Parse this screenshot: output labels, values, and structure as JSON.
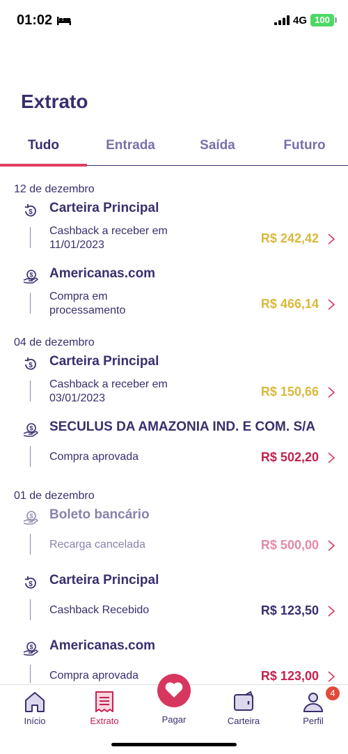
{
  "status": {
    "time": "01:02",
    "network": "4G",
    "battery": "100"
  },
  "header": {
    "title": "Extrato"
  },
  "tabs": [
    {
      "label": "Tudo",
      "active": true
    },
    {
      "label": "Entrada",
      "active": false
    },
    {
      "label": "Saída",
      "active": false
    },
    {
      "label": "Futuro",
      "active": false
    }
  ],
  "groups": [
    {
      "date": "12 de dezembro",
      "entries": [
        {
          "icon": "cashback-icon",
          "name": "Carteira Principal",
          "desc": "Cashback a receber em 11/01/2023",
          "amount": "R$ 242,42",
          "status": "pending"
        },
        {
          "icon": "money-hand-icon",
          "name": "Americanas.com",
          "desc": "Compra em processamento",
          "amount": "R$ 466,14",
          "status": "pending"
        }
      ]
    },
    {
      "date": "04 de dezembro",
      "entries": [
        {
          "icon": "cashback-icon",
          "name": "Carteira Principal",
          "desc": "Cashback a receber em 03/01/2023",
          "amount": "R$ 150,66",
          "status": "pending"
        },
        {
          "icon": "money-hand-icon",
          "name": "SECULUS DA AMAZONIA IND. E COM. S/A",
          "desc": "Compra aprovada",
          "amount": "R$ 502,20",
          "status": "approved"
        }
      ]
    },
    {
      "date": "01 de dezembro",
      "entries": [
        {
          "icon": "money-hand-icon",
          "name": "Boleto bancário",
          "desc": "Recarga cancelada",
          "amount": "R$ 500,00",
          "status": "cancelled"
        },
        {
          "icon": "cashback-icon",
          "name": "Carteira Principal",
          "desc": "Cashback Recebido",
          "amount": "R$ 123,50",
          "status": "received"
        },
        {
          "icon": "money-hand-icon",
          "name": "Americanas.com",
          "desc": "Compra aprovada",
          "amount": "R$ 123,00",
          "status": "approved"
        }
      ]
    }
  ],
  "colors": {
    "primary": "#3a2e6e",
    "accent": "#d7375f",
    "pending": "#d9b93c",
    "approved": "#c3224f",
    "cancelled": "#e28aa8"
  },
  "nav": {
    "home": "Início",
    "statement": "Extrato",
    "pay": "Pagar",
    "wallet": "Carteira",
    "profile": "Perfil",
    "profile_badge": "4"
  }
}
